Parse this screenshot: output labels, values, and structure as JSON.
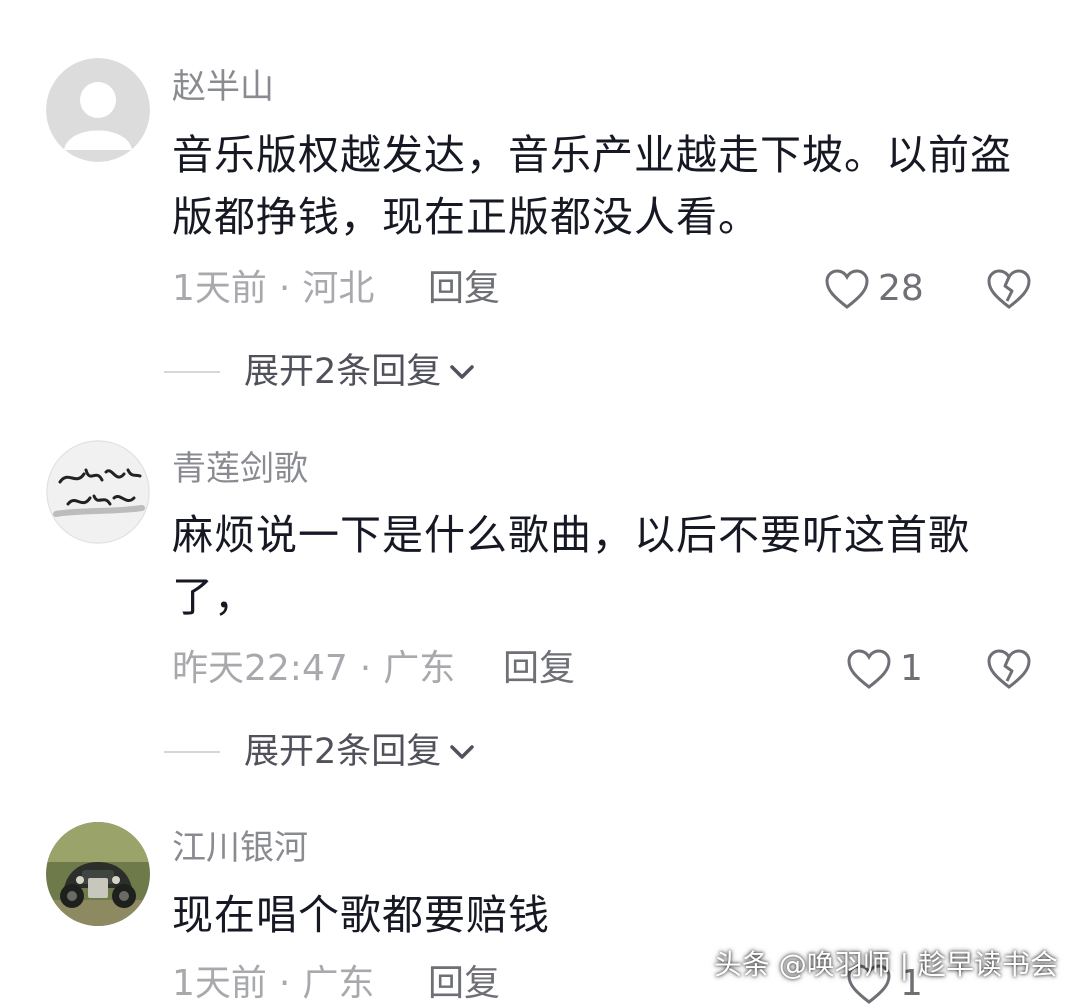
{
  "comments": [
    {
      "username": "赵半山",
      "avatar_icon": "default-user-avatar",
      "content": "音乐版权越发达，音乐产业越走下坡。以前盗版都挣钱，现在正版都没人看。",
      "time": "1天前",
      "location": "河北",
      "reply_label": "回复",
      "likes": "28",
      "expand_label": "展开2条回复"
    },
    {
      "username": "青莲剑歌",
      "avatar_icon": "calligraphy-avatar",
      "content": "麻烦说一下是什么歌曲，以后不要听这首歌了，",
      "time": "昨天22:47",
      "location": "广东",
      "reply_label": "回复",
      "likes": "1",
      "expand_label": "展开2条回复"
    },
    {
      "username": "江川银河",
      "avatar_icon": "vintage-car-avatar",
      "content": "现在唱个歌都要赔钱",
      "time": "1天前",
      "location": "广东",
      "reply_label": "回复",
      "likes": "1"
    }
  ],
  "meta_separator": "·",
  "watermark": "头条 @唤羽师 | 趁早读书会",
  "colors": {
    "username": "#8a8b91",
    "content": "#161823",
    "meta": "#a8a9ad",
    "icon_stroke": "#6f7076"
  }
}
